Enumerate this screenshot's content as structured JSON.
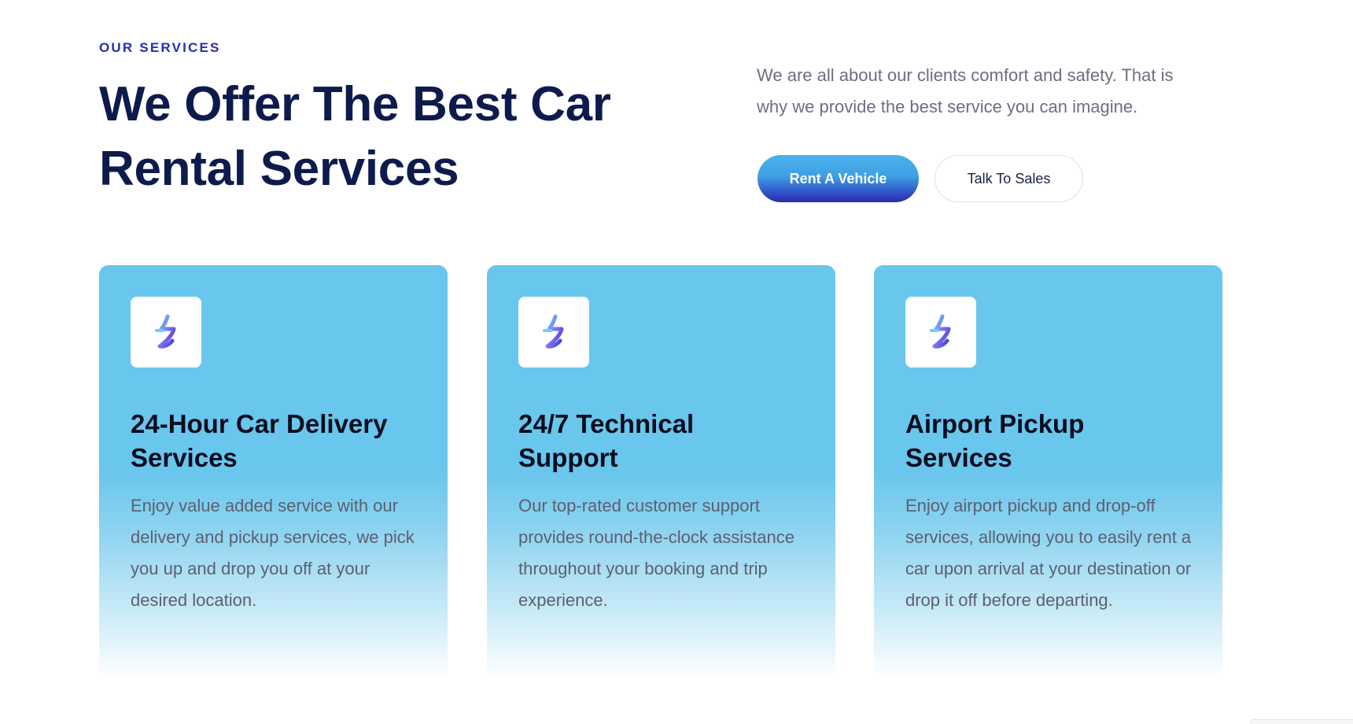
{
  "section": {
    "eyebrow": "OUR SERVICES",
    "heading_line1": "We Offer The Best Car",
    "heading_line2": "Rental Services",
    "intro_line1": "We are all about our clients comfort and safety. That is",
    "intro_line2": "why we provide the best service you can imagine."
  },
  "buttons": {
    "primary_label": "Rent A Vehicle",
    "secondary_label": "Talk To Sales"
  },
  "cards": [
    {
      "icon": "bolt-logo-icon",
      "title_line1": "24-Hour Car Delivery",
      "title_line2": "Services",
      "text": "Enjoy value added service with our delivery and pickup services, we pick you up and drop you off at your desired location."
    },
    {
      "icon": "bolt-logo-icon",
      "title_line1": "24/7 Technical",
      "title_line2": "Support",
      "text": "Our top-rated customer support provides round-the-clock assistance throughout your booking and trip experience."
    },
    {
      "icon": "bolt-logo-icon",
      "title_line1": "Airport Pickup",
      "title_line2": "Services",
      "text": "Enjoy airport pickup and drop-off services, allowing you to easily rent a car upon arrival at your destination or drop it off before departing."
    }
  ],
  "colors": {
    "eyebrow": "#2a2eb3",
    "heading": "#0d1b4c",
    "card_blue": "#69c6ec",
    "button_gradient_top": "#4ab3ec",
    "button_gradient_bottom": "#2b2aa8"
  }
}
